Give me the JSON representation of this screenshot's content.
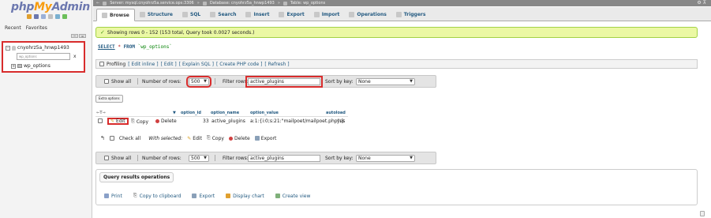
{
  "logo": {
    "php": "php",
    "my": "My",
    "admin": "Admin"
  },
  "left": {
    "recent": "Recent",
    "favorites": "Favorites",
    "db_name": "cnyohrz5a_hnwp1493",
    "filter_placeholder": "wp_options",
    "filter_clear": "x",
    "table_name": "wp_options"
  },
  "topbar": {
    "server": "Server: mysql.cnyohrz5a.service.ops:3306",
    "database": "Database: cnyohrz5a_hnwp1493",
    "table": "Table: wp_options"
  },
  "tabs": [
    "Browse",
    "Structure",
    "SQL",
    "Search",
    "Insert",
    "Export",
    "Import",
    "Operations",
    "Triggers"
  ],
  "success": "Showing rows 0 - 152 (153 total, Query took 0.0027 seconds.)",
  "sql": {
    "select": "SELECT",
    "star": "*",
    "from": "FROM",
    "table": "`wp_options`"
  },
  "profiling": {
    "label": "Profiling",
    "edit_inline": "[ Edit inline ]",
    "edit": "[ Edit ]",
    "explain": "[ Explain SQL ]",
    "create_php": "[ Create PHP code ]",
    "refresh": "[ Refresh ]"
  },
  "nav_top": {
    "show_all": "Show all",
    "num_rows_label": "Number of rows:",
    "num_rows_value": "500",
    "filter_label": "Filter rows:",
    "filter_value": "active_plugins",
    "sort_label": "Sort by key:",
    "sort_value": "None"
  },
  "nav_bottom": {
    "show_all": "Show all",
    "num_rows_label": "Number of rows:",
    "num_rows_value": "500",
    "filter_label": "Filter rows:",
    "filter_value": "active_plugins",
    "sort_label": "Sort by key:",
    "sort_value": "None"
  },
  "extra_options": "Extra options",
  "table": {
    "headers": {
      "option_id": "option_id",
      "option_name": "option_name",
      "option_value": "option_value",
      "autoload": "autoload"
    },
    "row": {
      "edit": "Edit",
      "copy": "Copy",
      "delete": "Delete",
      "option_id": "33",
      "option_name": "active_plugins",
      "option_value": "a:1:{i:0;s:21:\"mailpoet/mailpoet.php\";}",
      "autoload": "yes"
    }
  },
  "with_selected": {
    "check_all": "Check all",
    "with_selected": "With selected:",
    "edit": "Edit",
    "copy": "Copy",
    "delete": "Delete",
    "export": "Export"
  },
  "qro": {
    "title": "Query results operations",
    "print": "Print",
    "copy_clipboard": "Copy to clipboard",
    "export": "Export",
    "display_chart": "Display chart",
    "create_view": "Create view"
  },
  "colors": {
    "accent": "#235a81",
    "highlight": "#d82c2c",
    "success_bg": "#ebf8a4"
  }
}
